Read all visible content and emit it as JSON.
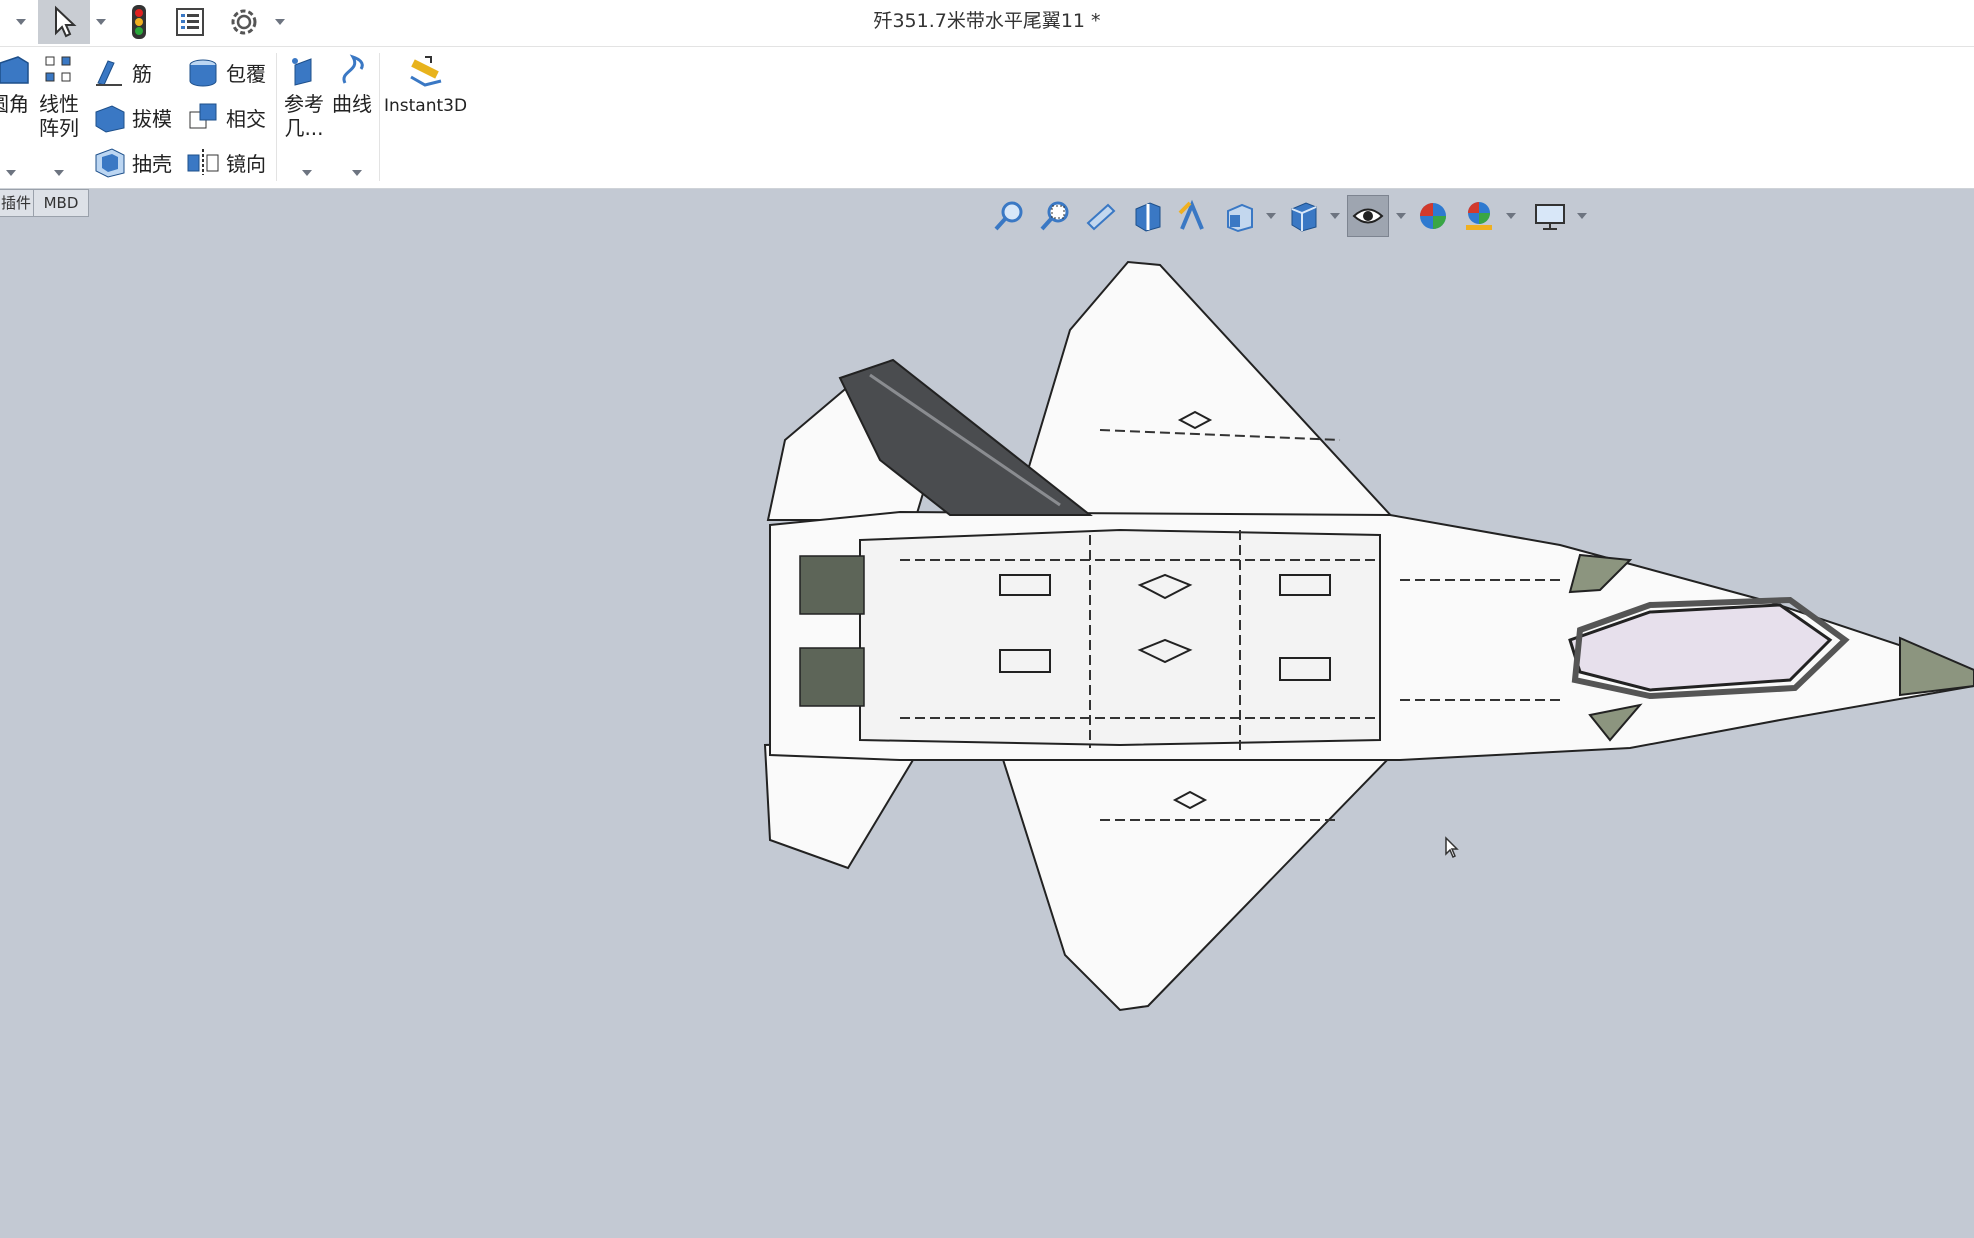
{
  "window": {
    "title": "歼351.7米带水平尾翼11 *"
  },
  "ribbon": {
    "fillet_label": "圆角",
    "linear_pattern_label": "线性\n阵列",
    "rib_label": "筋",
    "draft_label": "拔模",
    "shell_label": "抽壳",
    "wrap_label": "包覆",
    "intersect_label": "相交",
    "mirror_label": "镜向",
    "ref_geometry_label": "参考\n几...",
    "curves_label": "曲线",
    "instant3d_label": "Instant3D"
  },
  "tabs": {
    "plugins_label": "插件",
    "mbd_label": "MBD"
  },
  "colors": {
    "viewport_bg": "#c3c9d3",
    "accent_blue": "#3a78c4",
    "model_dark": "#4a4c4f"
  }
}
